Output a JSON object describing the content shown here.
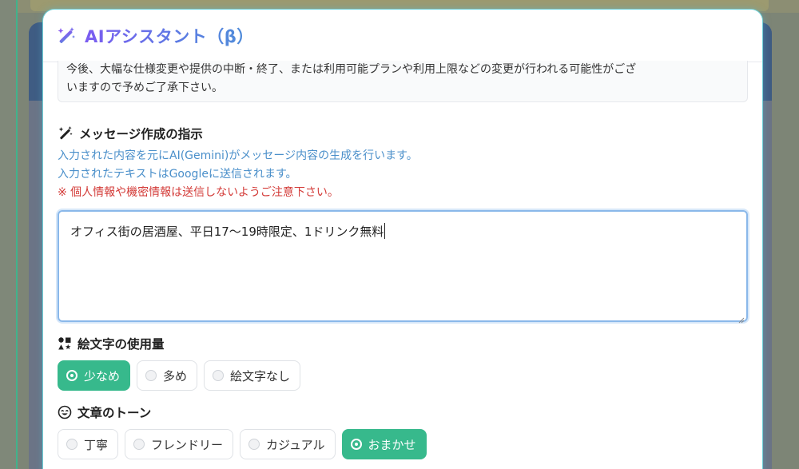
{
  "modal": {
    "title": "AIアシスタント（β）"
  },
  "notice": {
    "line1": "今後、大幅な仕様変更や提供の中断・終了、または利用可能プランや利用上限などの変更が行われる可能性がござ",
    "line2": "いますので予めご了承下さい。"
  },
  "instruction": {
    "title": "メッセージ作成の指示",
    "info1": "入力された内容を元にAI(Gemini)がメッセージ内容の生成を行います。",
    "info2": "入力されたテキストはGoogleに送信されます。",
    "warning": "※ 個人情報や機密情報は送信しないようご注意下さい。",
    "input_value": "オフィス街の居酒屋、平日17〜19時限定、1ドリンク無料"
  },
  "emoji_usage": {
    "title": "絵文字の使用量",
    "options": [
      "少なめ",
      "多め",
      "絵文字なし"
    ],
    "selected": "少なめ"
  },
  "tone": {
    "title": "文章のトーン",
    "options": [
      "丁寧",
      "フレンドリー",
      "カジュアル",
      "おまかせ"
    ],
    "selected": "おまかせ"
  },
  "colors": {
    "accent": "#37b98c",
    "info": "#4a8fca",
    "warning": "#d33a37",
    "title_gradient_start": "#7b5cf1",
    "title_gradient_end": "#4f8fd8"
  },
  "icons": {
    "title": "magic-wand-icon",
    "instruction": "magic-wand-icon",
    "emoji_usage": "emoji-shapes-icon",
    "tone": "smile-icon"
  }
}
